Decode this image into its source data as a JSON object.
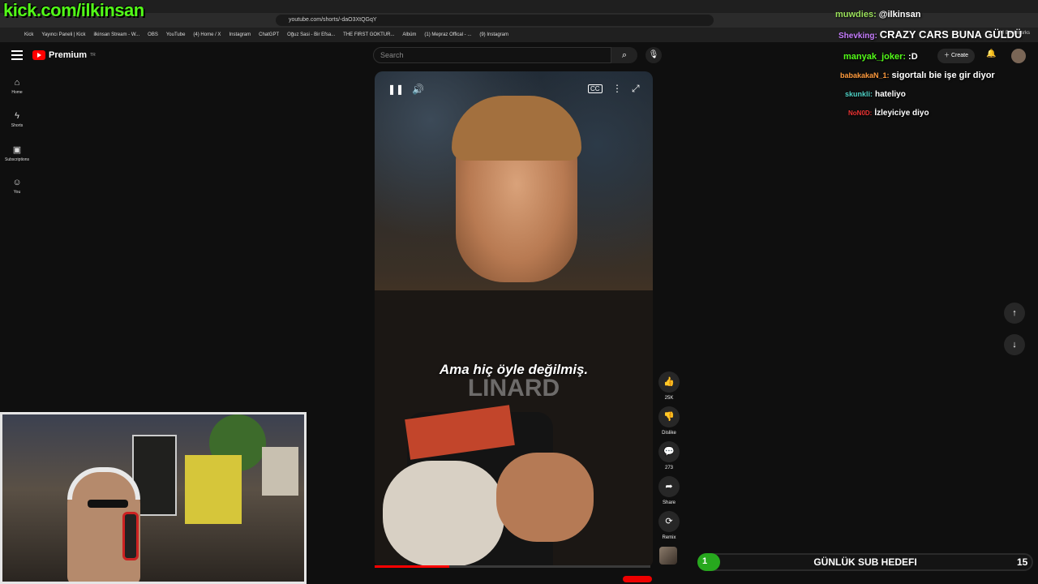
{
  "browser": {
    "url": "youtube.com/shorts/-daO3XtQGqY",
    "all_bookmarks": "All Bookmarks",
    "bookmarks": [
      "Kick",
      "Yayıncı Paneli | Kick",
      "ilkinsan Stream - W...",
      "OBS",
      "YouTube",
      "(4) Home / X",
      "Instagram",
      "ChatGPT",
      "Oğuz Sasi - Bir Efsa...",
      "THE FIRST GOKTUR...",
      "Albüm",
      "(1) Mepraz Offical - ...",
      "(9) Instagram"
    ]
  },
  "youtube": {
    "logo_text": "Premium",
    "logo_region": "TR",
    "search_placeholder": "Search",
    "create_label": "Create",
    "sidebar": [
      {
        "icon": "home-icon",
        "label": "Home",
        "glyph": "⌂"
      },
      {
        "icon": "shorts-icon",
        "label": "Shorts",
        "glyph": "ϟ"
      },
      {
        "icon": "subscriptions-icon",
        "label": "Subscriptions",
        "glyph": "▣"
      },
      {
        "icon": "you-icon",
        "label": "You",
        "glyph": "☺"
      }
    ]
  },
  "video": {
    "subtitle": "Ama hiç öyle değilmiş.",
    "watermark": "LINARD",
    "progress": 0.27
  },
  "actions": {
    "like_count": "25K",
    "dislike_label": "Dislike",
    "comments_count": "273",
    "share_label": "Share",
    "remix_label": "Remix"
  },
  "overlay": {
    "kick_banner": "kick.com/ilkinsan",
    "chat": [
      {
        "user": "muwdies:",
        "user_color": "#9ae05a",
        "message": "@ilkinsan"
      },
      {
        "user": "Shevking:",
        "user_color": "#c77dff",
        "message": "CRAZY CARS BUNA GÜLDÜ"
      },
      {
        "user": "manyak_joker:",
        "user_color": "#53fc18",
        "message": ":D"
      },
      {
        "user": "babakakaN_1:",
        "user_color": "#ff9b3d",
        "message": "sigortalı bie işe gir diyor"
      },
      {
        "user": "skunkli:",
        "user_color": "#4fd1c5",
        "message": "hateliyo"
      },
      {
        "user": "NoN0D:",
        "user_color": "#e33",
        "message": "İzleyiciye diyo"
      }
    ],
    "subgoal": {
      "title": "GÜNLÜK SUB HEDEFI",
      "current": "1",
      "target": "15",
      "fraction": 0.067
    }
  },
  "colors": {
    "kick_green": "#53fc18",
    "yt_red": "#ff0000",
    "goal_green": "#27a81e"
  }
}
